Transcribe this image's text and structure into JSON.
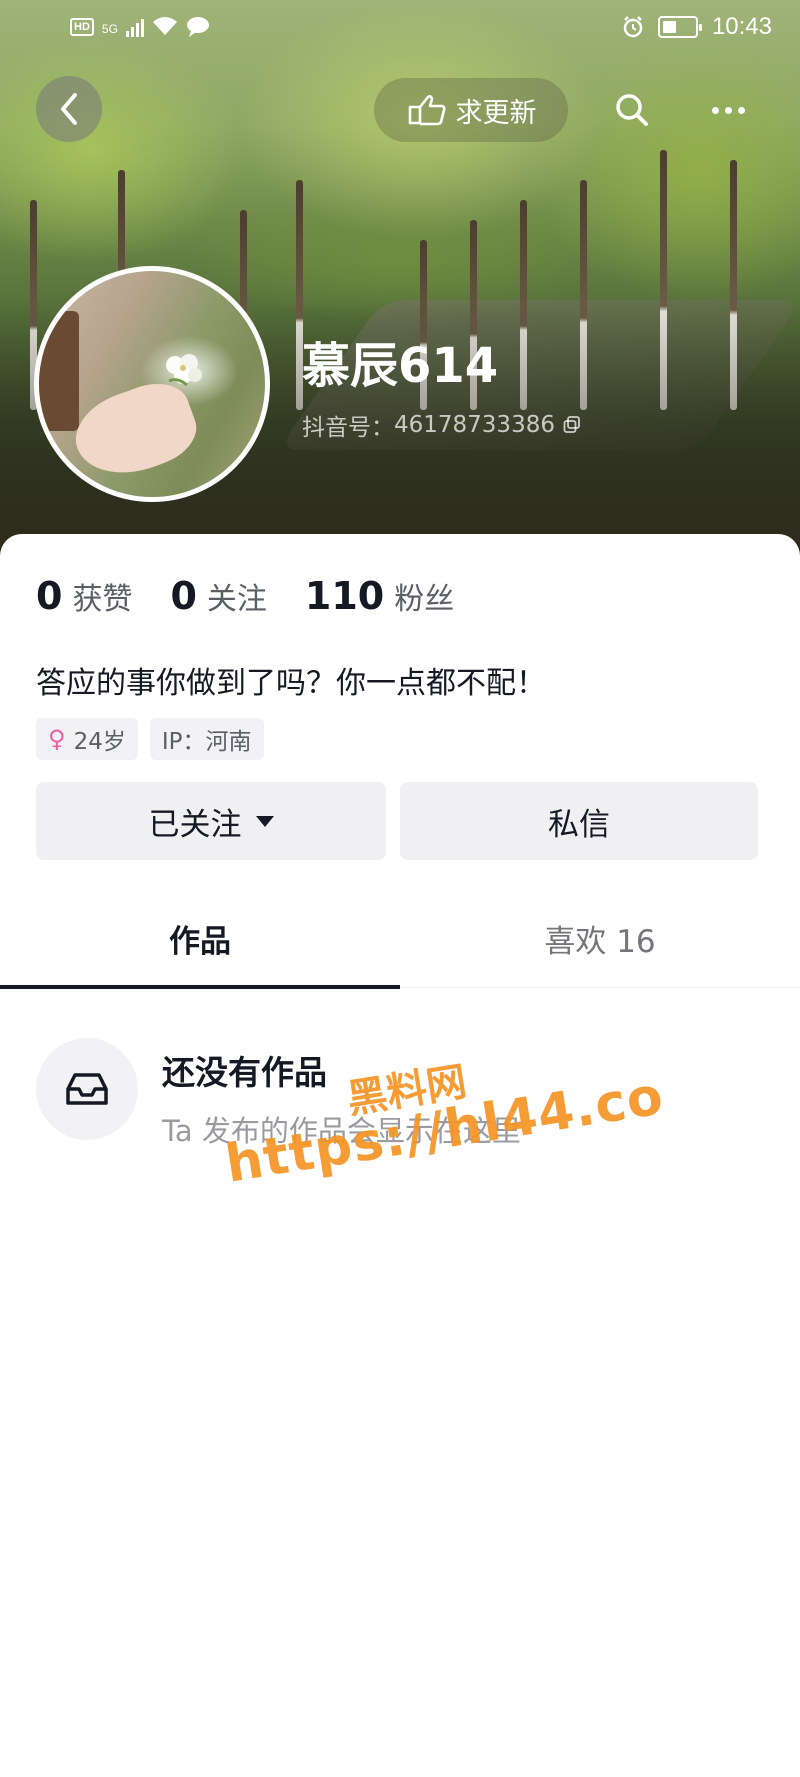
{
  "status_bar": {
    "hd_badge": "HD",
    "network": "5G",
    "time": "10:43",
    "battery_level": 0.35
  },
  "nav": {
    "update_label": "求更新"
  },
  "profile": {
    "name": "慕辰614",
    "id_label": "抖音号：",
    "id_value": "46178733386"
  },
  "stats": [
    {
      "value": "0",
      "label": "获赞"
    },
    {
      "value": "0",
      "label": "关注"
    },
    {
      "value": "110",
      "label": "粉丝"
    }
  ],
  "bio": "答应的事你做到了吗？你一点都不配！",
  "tags": {
    "age": "24岁",
    "ip": "IP：河南"
  },
  "actions": {
    "follow_label": "已关注",
    "message_label": "私信"
  },
  "tabs": [
    {
      "label": "作品",
      "active": true
    },
    {
      "label": "喜欢 16",
      "active": false
    }
  ],
  "empty_state": {
    "title": "还没有作品",
    "subtitle": "Ta 发布的作品会显示在这里"
  },
  "watermark": {
    "line1": "黑料网",
    "line2": "https://hl44.co"
  },
  "colors": {
    "accent_female": "#f05fa6",
    "watermark": "#f49424",
    "text_primary": "#161823",
    "text_secondary": "#5c5e66"
  },
  "icons": [
    "back-chevron-icon",
    "pointing-hand-icon",
    "search-icon",
    "more-dots-icon",
    "copy-icon",
    "female-icon",
    "caret-down-icon",
    "inbox-tray-icon"
  ]
}
